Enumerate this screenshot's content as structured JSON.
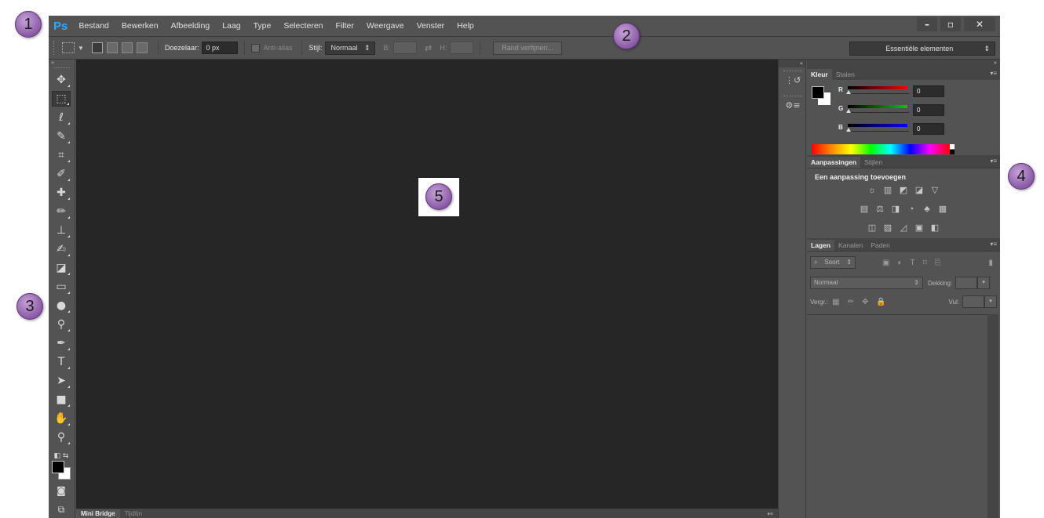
{
  "app": {
    "logo": "Ps"
  },
  "menu": [
    "Bestand",
    "Bewerken",
    "Afbeelding",
    "Laag",
    "Type",
    "Selecteren",
    "Filter",
    "Weergave",
    "Venster",
    "Help"
  ],
  "window_controls": {
    "minimize": "–",
    "restore": "▫",
    "close": "✕"
  },
  "options_bar": {
    "feather_label": "Doezelaar:",
    "feather_value": "0 px",
    "antialias_label": "Anti-alias",
    "style_label": "Stijl:",
    "style_value": "Normaal",
    "width_label": "B:",
    "height_label": "H:",
    "refine_button": "Rand verfijnen...",
    "workspace": "Essentiële elementen"
  },
  "tools_top": "»",
  "tools": [
    {
      "name": "move-tool-icon",
      "glyph": "✥"
    },
    {
      "name": "marquee-tool-icon",
      "glyph": "⬚"
    },
    {
      "name": "lasso-tool-icon",
      "glyph": "ℓ"
    },
    {
      "name": "quick-select-tool-icon",
      "glyph": "✎"
    },
    {
      "name": "crop-tool-icon",
      "glyph": "⌗"
    },
    {
      "name": "eyedropper-tool-icon",
      "glyph": "✐"
    },
    {
      "name": "healing-brush-tool-icon",
      "glyph": "✚"
    },
    {
      "name": "brush-tool-icon",
      "glyph": "✏"
    },
    {
      "name": "stamp-tool-icon",
      "glyph": "⊥"
    },
    {
      "name": "history-brush-tool-icon",
      "glyph": "✍"
    },
    {
      "name": "eraser-tool-icon",
      "glyph": "◪"
    },
    {
      "name": "gradient-tool-icon",
      "glyph": "▭"
    },
    {
      "name": "blur-tool-icon",
      "glyph": "●"
    },
    {
      "name": "dodge-tool-icon",
      "glyph": "⚲"
    },
    {
      "name": "pen-tool-icon",
      "glyph": "✒"
    },
    {
      "name": "type-tool-icon",
      "glyph": "T"
    },
    {
      "name": "path-select-tool-icon",
      "glyph": "➤"
    },
    {
      "name": "rectangle-tool-icon",
      "glyph": "■"
    },
    {
      "name": "hand-tool-icon",
      "glyph": "✋"
    },
    {
      "name": "zoom-tool-icon",
      "glyph": "⚲"
    }
  ],
  "bottom_tabs": [
    "Mini Bridge",
    "Tijdlijn"
  ],
  "panels": {
    "color": {
      "tabs": [
        "Kleur",
        "Stalen"
      ],
      "rows": [
        {
          "label": "R",
          "value": "0",
          "color": "#ff0000"
        },
        {
          "label": "G",
          "value": "0",
          "color": "#00cc00"
        },
        {
          "label": "B",
          "value": "0",
          "color": "#0000ff"
        }
      ]
    },
    "adjustments": {
      "tabs": [
        "Aanpassingen",
        "Stijlen"
      ],
      "title": "Een aanpassing toevoegen"
    },
    "layers": {
      "tabs": [
        "Lagen",
        "Kanalen",
        "Paden"
      ],
      "filter": "Soort",
      "blend_mode": "Normaal",
      "opacity_label": "Dekking:",
      "lock_label": "Vergr.:",
      "fill_label": "Vul:"
    }
  },
  "callouts": [
    "1",
    "2",
    "3",
    "4",
    "5"
  ]
}
